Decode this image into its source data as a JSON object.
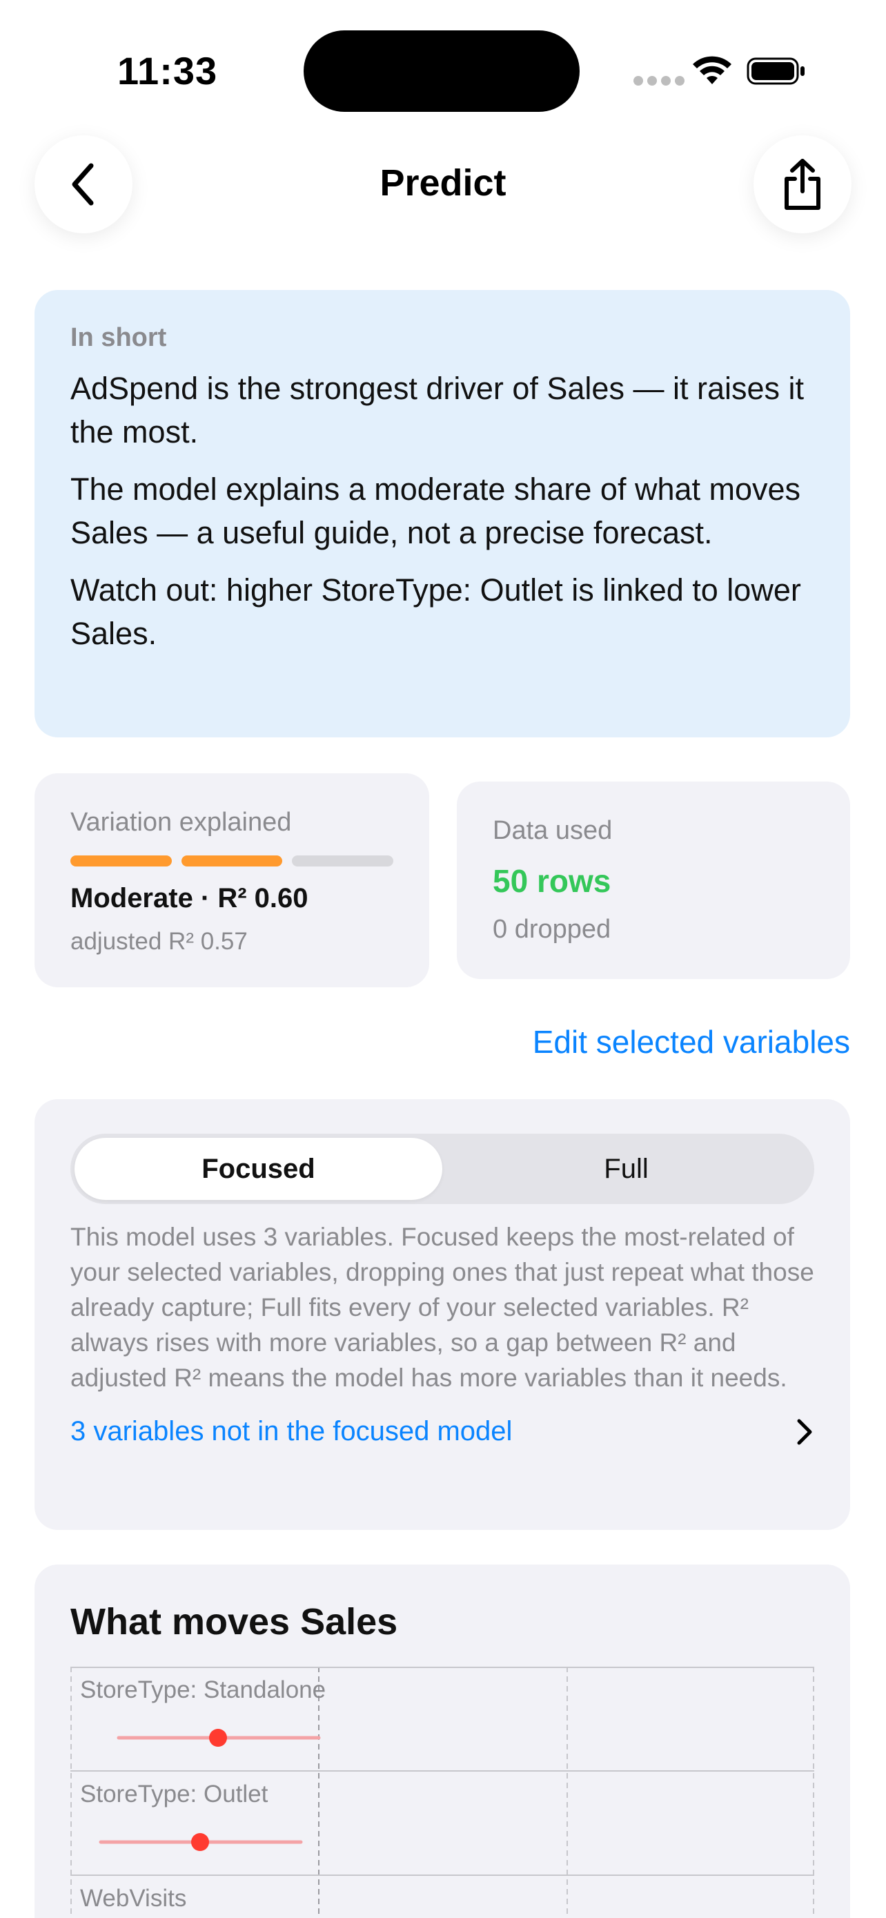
{
  "status": {
    "time": "11:33"
  },
  "nav": {
    "title": "Predict",
    "back_icon": "chevron-left-icon",
    "share_icon": "share-icon"
  },
  "summary": {
    "label": "In short",
    "lines": [
      "AdSpend is the strongest driver of Sales — it raises it the most.",
      "The model explains a moderate share of what moves Sales — a useful guide, not a precise forecast.",
      "Watch out: higher StoreType: Outlet is linked to lower Sales."
    ]
  },
  "variation": {
    "label": "Variation explained",
    "level": "Moderate · R² 0.60",
    "adjusted": "adjusted R² 0.57",
    "filled_segments": 2,
    "total_segments": 3,
    "fill_color": "#ff9a2e",
    "empty_color": "#d8d8dc"
  },
  "data_used": {
    "label": "Data used",
    "rows": "50 rows",
    "dropped": "0 dropped",
    "rows_color": "#34c759"
  },
  "edit_link": "Edit selected variables",
  "model": {
    "tabs": [
      {
        "label": "Focused",
        "active": true
      },
      {
        "label": "Full",
        "active": false
      }
    ],
    "description": "This model uses 3 variables. Focused keeps the most-related of your selected variables, dropping ones that just repeat what those already capture; Full fits every of your selected variables. R² always rises with more variables, so a gap between R² and adjusted R² means the model has more variables than it needs.",
    "excluded_link": "3 variables not in the focused model"
  },
  "drivers": {
    "title": "What moves Sales",
    "rows": [
      {
        "label": "StoreType: Standalone"
      },
      {
        "label": "StoreType: Outlet"
      },
      {
        "label": "WebVisits"
      }
    ]
  },
  "colors": {
    "accent": "#0a84ff",
    "summary_bg": "#e3f0fc",
    "card_bg": "#f2f2f7",
    "negative": "#ff3b30"
  }
}
